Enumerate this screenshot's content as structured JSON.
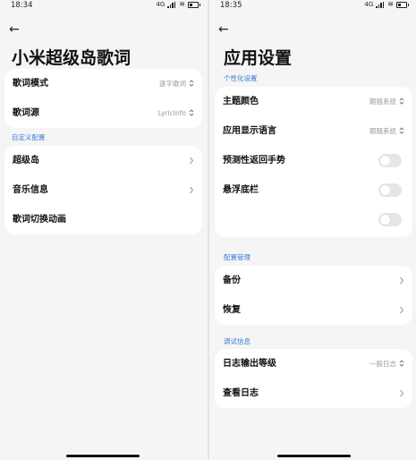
{
  "left": {
    "status": {
      "time": "18:34",
      "signal": "4G"
    },
    "title": "小米超级岛歌词",
    "card1": {
      "rows": [
        {
          "label": "歌词模式",
          "value": "逐字歌词"
        },
        {
          "label": "歌词源",
          "value": "LyricInfo"
        }
      ]
    },
    "section1": "自定义配置",
    "card2": {
      "rows": [
        {
          "label": "超级岛"
        },
        {
          "label": "音乐信息"
        },
        {
          "label": "歌词切换动画"
        }
      ]
    }
  },
  "right": {
    "status": {
      "time": "18:35",
      "signal": "4G"
    },
    "title": "应用设置",
    "section1": "个性化设置",
    "card1": {
      "rows": [
        {
          "label": "主题颜色",
          "value": "跟随系统"
        },
        {
          "label": "应用显示语言",
          "value": "跟随系统"
        },
        {
          "label": "预测性返回手势",
          "toggle": false
        },
        {
          "label": "悬浮底栏",
          "toggle": false
        },
        {
          "label": "",
          "toggle": false
        }
      ]
    },
    "section2": "配置管理",
    "card2": {
      "rows": [
        {
          "label": "备份"
        },
        {
          "label": "恢复"
        }
      ]
    },
    "section3": "调试信息",
    "card3": {
      "rows": [
        {
          "label": "日志输出等级",
          "value": "一般日志"
        },
        {
          "label": "查看日志"
        }
      ]
    }
  },
  "colors": {
    "accent": "#3a7bd5",
    "background": "#f5f5f5",
    "card": "#ffffff"
  }
}
